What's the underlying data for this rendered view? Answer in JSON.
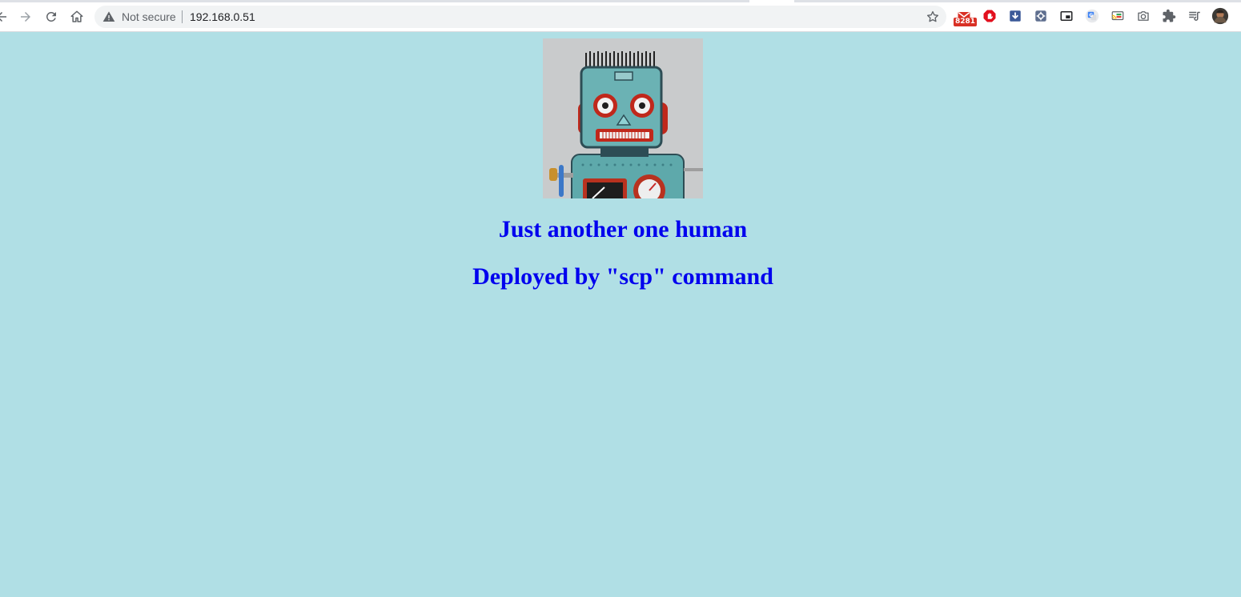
{
  "browser": {
    "security_label": "Not secure",
    "url": "192.168.0.51",
    "mail_badge": "8281",
    "icons": {
      "back": "back-arrow-icon",
      "forward": "forward-arrow-icon",
      "reload": "reload-icon",
      "home": "home-icon",
      "warning": "warning-triangle-icon",
      "bookmark": "star-icon",
      "extensions": [
        "gmail-notifier-icon",
        "adblock-icon",
        "download-icon",
        "puzzle-gear-icon",
        "picture-in-picture-icon",
        "google-translate-icon",
        "cast-icon",
        "screenshot-camera-icon",
        "extensions-puzzle-icon",
        "media-queue-icon",
        "profile-avatar-icon"
      ]
    }
  },
  "page": {
    "background_color": "#b0dfe5",
    "heading_color": "#0000ee",
    "image_alt": "toy robot",
    "heading_1": "Just another one human",
    "heading_2": "Deployed by \"scp\" command"
  }
}
